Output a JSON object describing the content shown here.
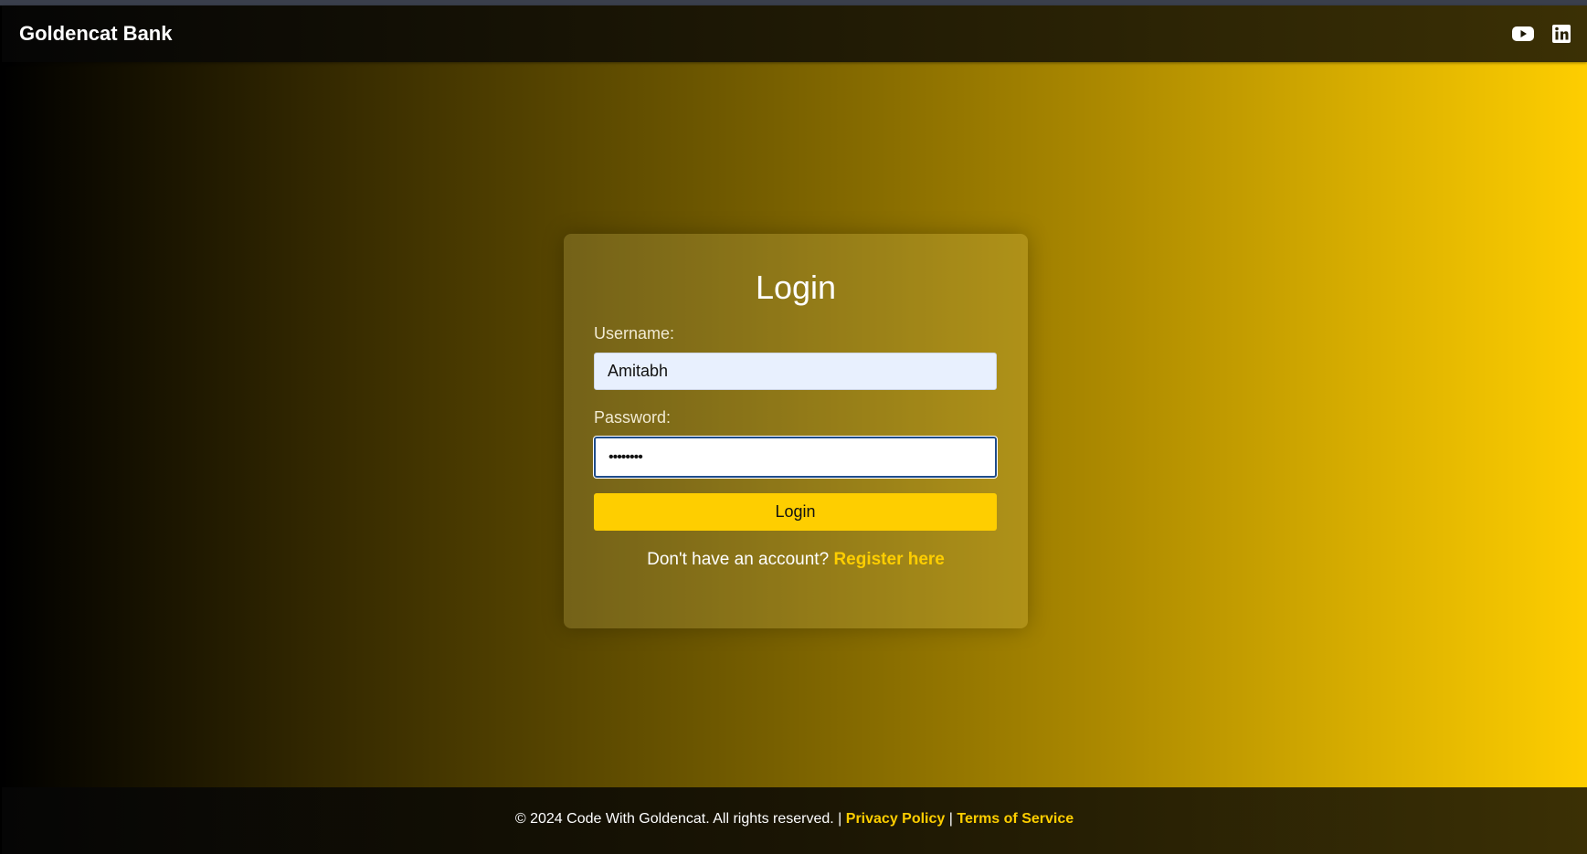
{
  "navbar": {
    "brand": "Goldencat Bank",
    "social": [
      {
        "icon": "youtube-icon"
      },
      {
        "icon": "linkedin-icon"
      }
    ]
  },
  "login": {
    "title": "Login",
    "username_label": "Username:",
    "username_value": "Amitabh",
    "password_label": "Password:",
    "password_value": "••••••••",
    "button_label": "Login",
    "register_prompt": "Don't have an account?",
    "register_link": "Register here"
  },
  "footer": {
    "copyright": "© 2024 Code With Goldencat. All rights reserved. |",
    "privacy": "Privacy Policy",
    "separator": "|",
    "terms": "Terms of Service"
  },
  "colors": {
    "accent": "#fece00",
    "gradient_start": "#000000",
    "gradient_end": "#fece00"
  }
}
